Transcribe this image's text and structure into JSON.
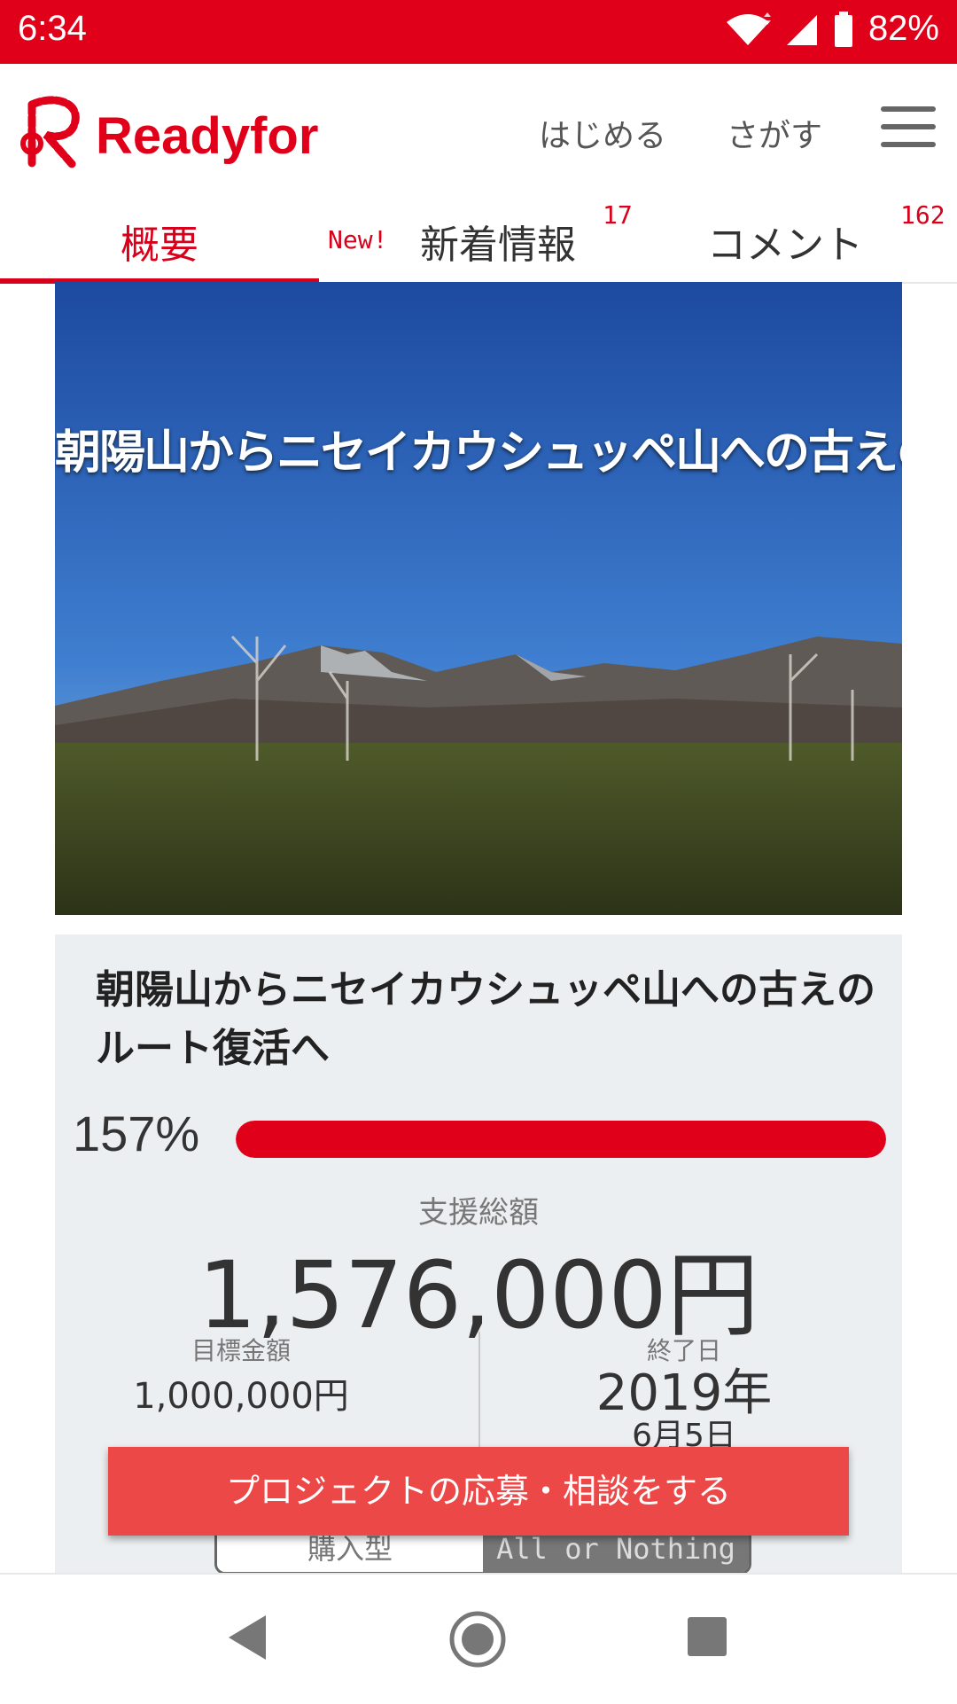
{
  "status_bar": {
    "time": "6:34",
    "battery": "82%"
  },
  "header": {
    "logo_text": "Readyfor",
    "nav": [
      "はじめる",
      "さがす"
    ]
  },
  "tabs": {
    "overview": "概要",
    "new_badge": "New!",
    "updates": "新着情報",
    "updates_count": "17",
    "comments": "コメント",
    "comments_count": "162"
  },
  "hero": {
    "title": "朝陽山からニセイカウシュッペ山への古えのルート復活へ"
  },
  "project": {
    "title": "朝陽山からニセイカウシュッペ山への古えのルート復活へ",
    "percent": "157%",
    "progress_fraction": 1.0,
    "amount_label": "支援総額",
    "amount": "1,576,000円",
    "goal_label": "目標金額",
    "goal": "1,000,000円",
    "end_label": "終了日",
    "end_year": "2019年",
    "end_date": "6月5日",
    "type_left": "購入型",
    "type_right": "All or Nothing"
  },
  "cta": {
    "label": "プロジェクトの応募・相談をする"
  },
  "colors": {
    "brand": "#e0001a",
    "cta": "#ec4848",
    "card_bg": "#eceff1"
  }
}
